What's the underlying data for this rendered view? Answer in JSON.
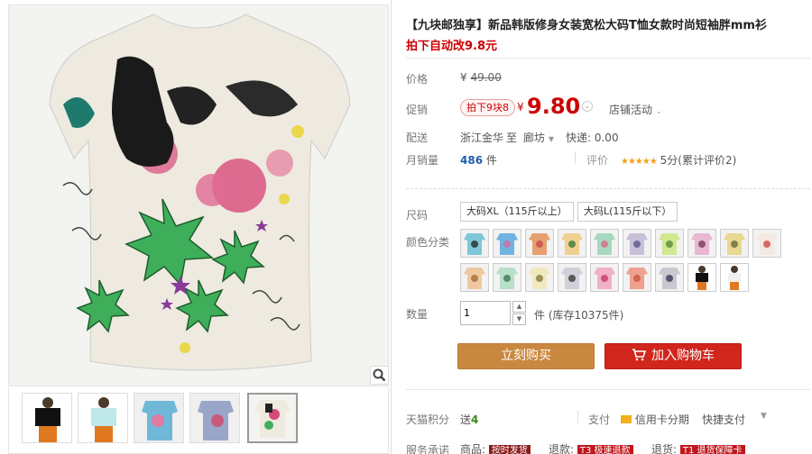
{
  "product": {
    "title": "【九块邮独享】新品韩版修身女装宽松大码T恤女款时尚短袖胖mm衫",
    "subtitle": "拍下自动改9.8元"
  },
  "price": {
    "label": "价格",
    "currency": "¥",
    "original": "49.00"
  },
  "promo": {
    "label": "促销",
    "tag": "拍下9块8",
    "currency": "¥",
    "price": "9.80",
    "store_activity": "店铺活动"
  },
  "shipping": {
    "label": "配送",
    "from": "浙江金华",
    "to_word": "至",
    "to": "廊坊",
    "fee": "快递: 0.00"
  },
  "sales": {
    "label": "月销量",
    "count": "486",
    "unit": "件",
    "review_label": "评价",
    "stars": "★★★★★",
    "review_text": "5分(累计评价2)"
  },
  "size": {
    "label": "尺码",
    "options": [
      "大码XL（115斤以上）",
      "大码L(115斤以下）"
    ]
  },
  "color": {
    "label": "颜色分类"
  },
  "quantity": {
    "label": "数量",
    "value": "1",
    "unit_stock": "件 (库存10375件)"
  },
  "buttons": {
    "buy": "立刻购买",
    "cart": "加入购物车"
  },
  "tmall_points": {
    "label": "天猫积分",
    "prefix": "送",
    "points": "4",
    "pay_label": "支付",
    "credit": "信用卡分期",
    "quick": "快捷支付"
  },
  "service": {
    "label": "服务承诺",
    "goods": "商品:",
    "goods_tag": "按时发货",
    "refund": "退款:",
    "refund_tag": "T3 极速退款",
    "return": "退货:",
    "return_tag": "T1 退货保障卡"
  },
  "colors": {
    "price_red": "#cc0000",
    "buy_button": "#c9883f",
    "cart_button": "#d0261c"
  }
}
